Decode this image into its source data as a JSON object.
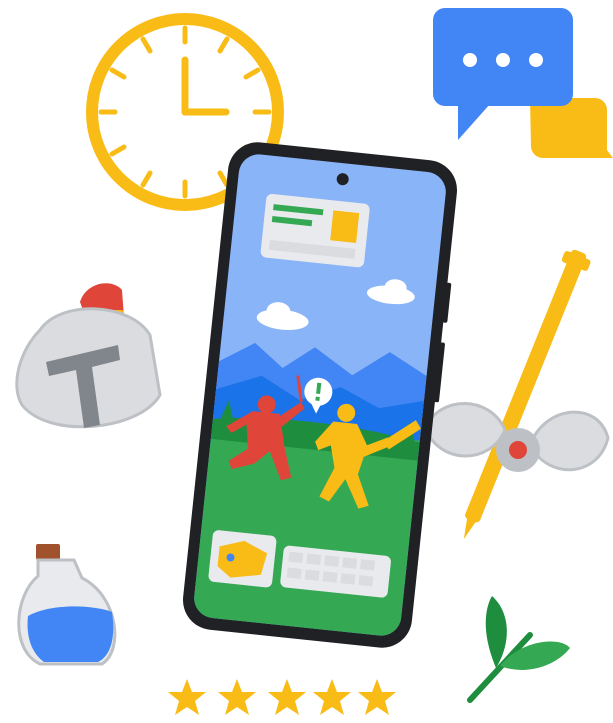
{
  "illustration": {
    "items": [
      "clock-icon",
      "chat-bubbles-icon",
      "knight-helmet-icon",
      "battle-axe-icon",
      "potion-bottle-icon",
      "sprout-icon",
      "phone-icon",
      "star-icon"
    ],
    "rating": {
      "stars": 5,
      "max": 5
    },
    "colors": {
      "yellow": "#F9BB16",
      "blue": "#4285F4",
      "red": "#E0453A",
      "green": "#34A853",
      "dark_green": "#1E8E3E",
      "phone_frame": "#202124",
      "grey": "#BDC1C6",
      "sky": "#8AB4F8"
    }
  }
}
